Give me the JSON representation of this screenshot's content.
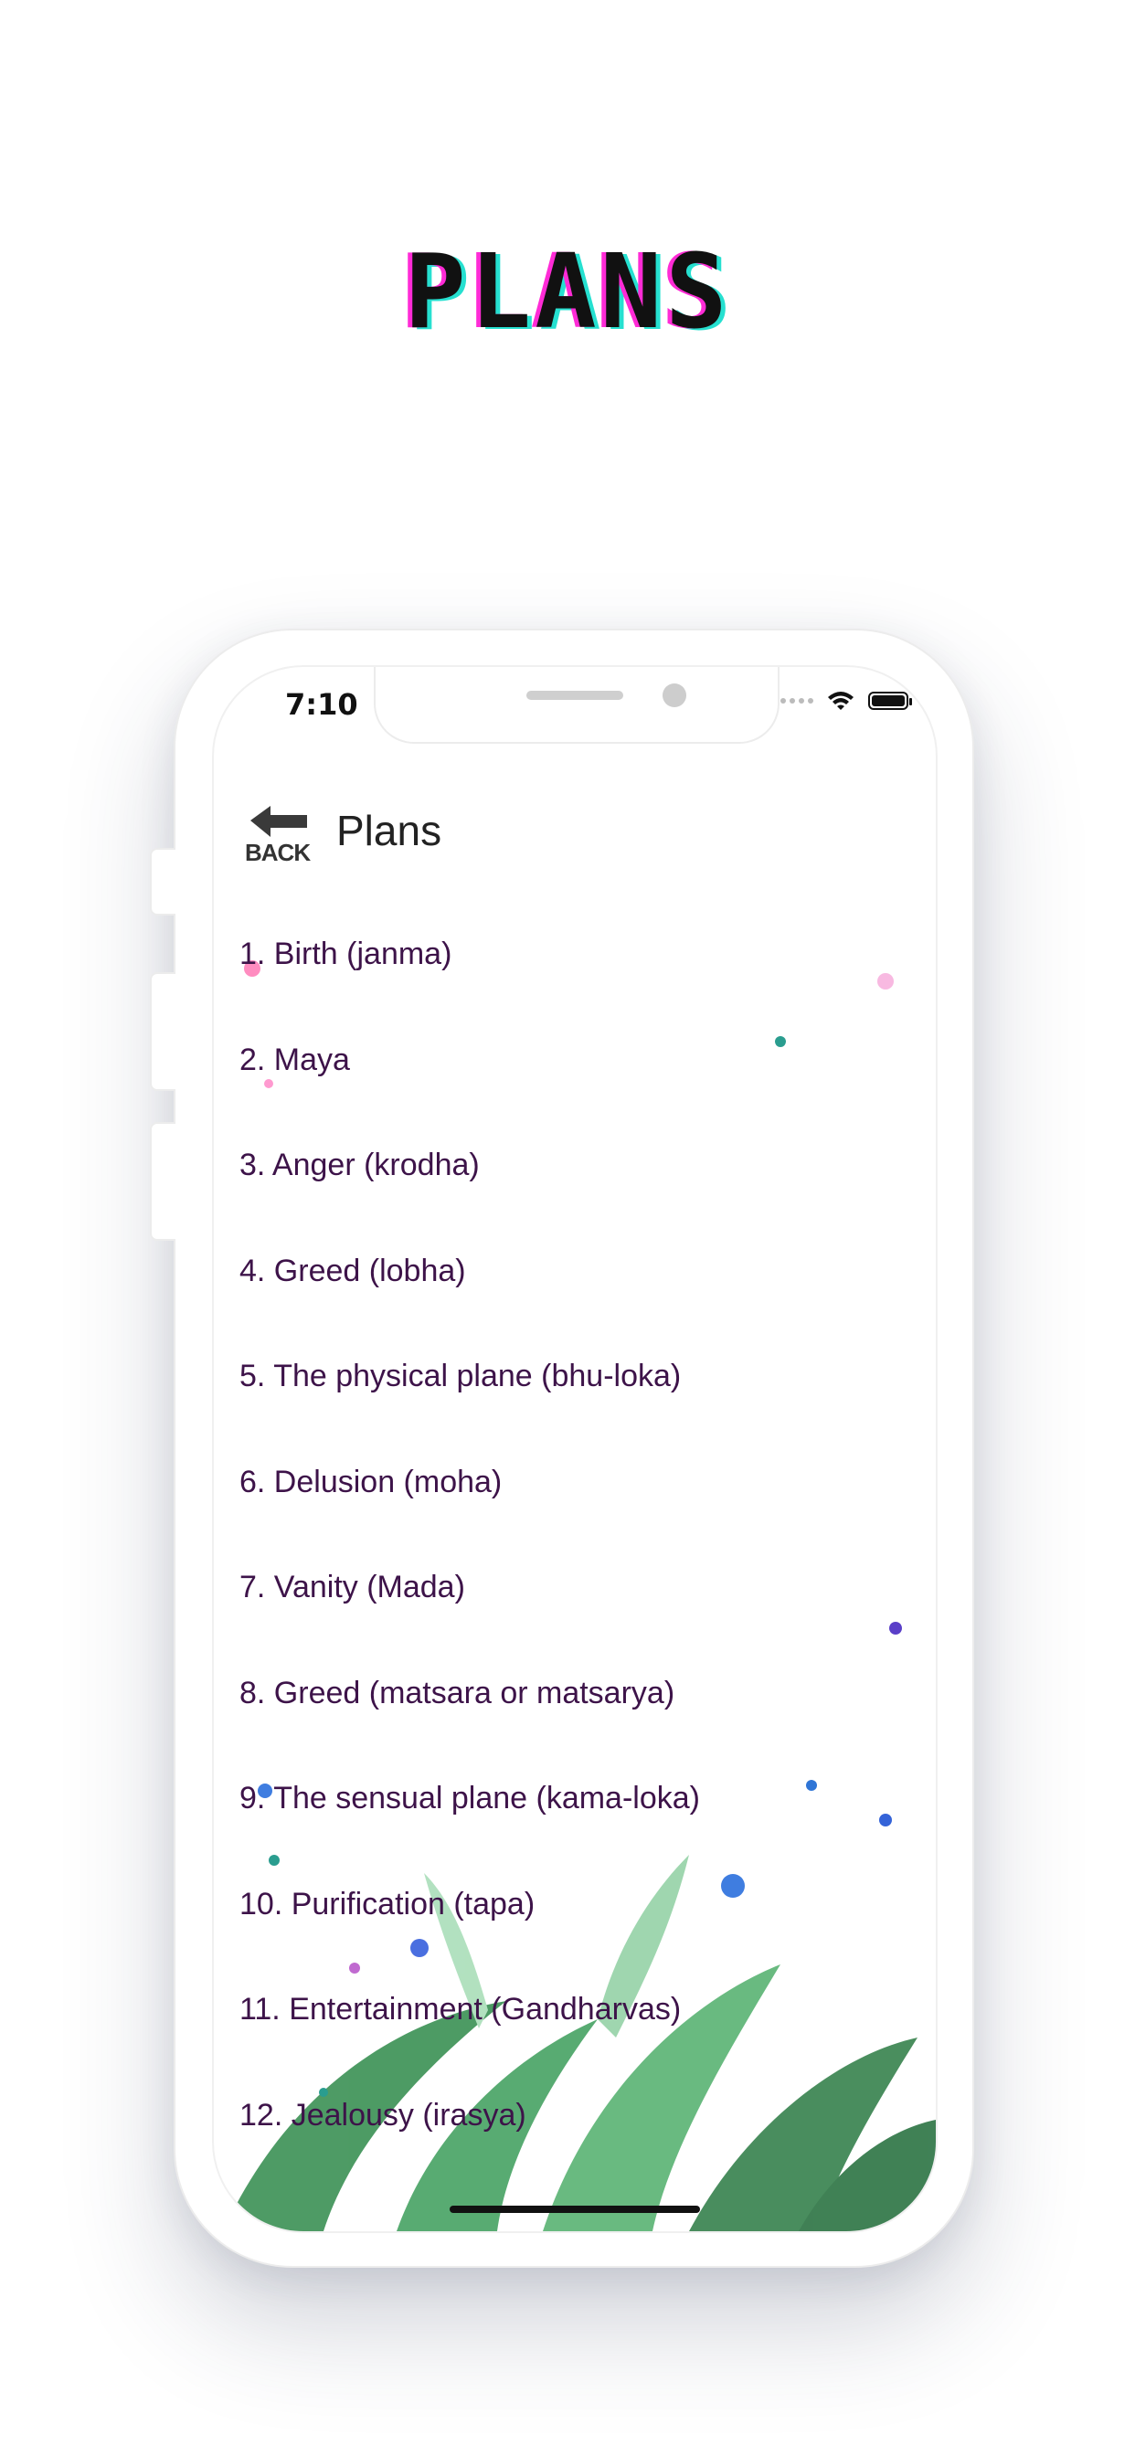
{
  "banner": {
    "title": "PLANS"
  },
  "status_bar": {
    "time": "7:10",
    "battery_level": 1.0
  },
  "header": {
    "back_label": "BACK",
    "title": "Plans"
  },
  "plans": [
    "1. Birth (janma)",
    "2. Maya",
    "3. Anger (krodha)",
    "4. Greed (lobha)",
    "5. The physical plane (bhu-loka)",
    "6. Delusion (moha)",
    "7. Vanity (Mada)",
    "8. Greed (matsara or matsarya)",
    "9. The sensual plane (kama-loka)",
    "10. Purification (tapa)",
    "11. Entertainment (Gandharvas)",
    "12. Jealousy (irasya)"
  ],
  "colors": {
    "list_text": "#3d1349",
    "headline_shadow_pink": "#ff2bd6",
    "headline_shadow_cyan": "#26e0d0",
    "leaf_green": "#2f8a4a"
  },
  "icons": [
    "back-arrow-icon",
    "wifi-icon",
    "battery-icon",
    "cellular-signal-icon"
  ]
}
